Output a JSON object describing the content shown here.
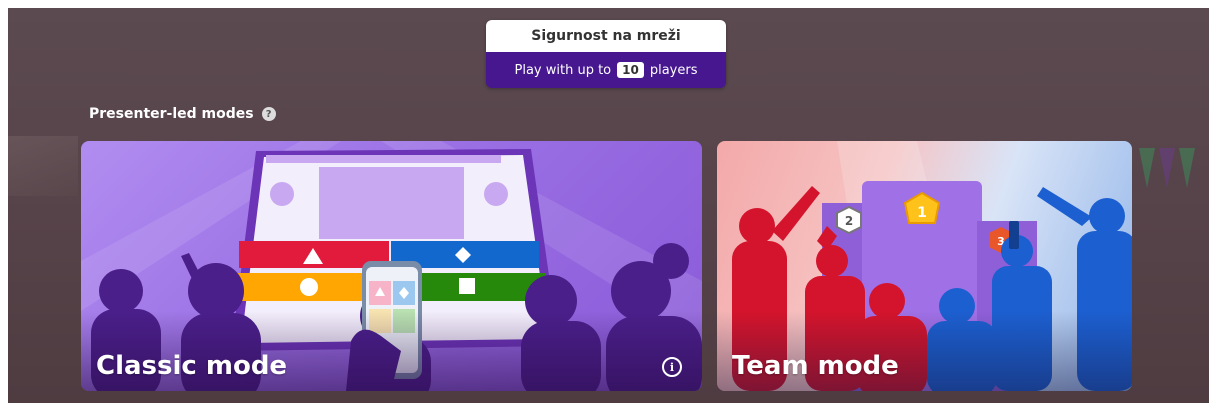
{
  "header": {
    "title": "Sigurnost na mreži",
    "players_prefix": "Play with up to",
    "player_count": "10",
    "players_suffix": "players"
  },
  "section": {
    "label": "Presenter-led modes",
    "help_icon": "?"
  },
  "modes": [
    {
      "title": "Classic mode",
      "info_icon": "i"
    },
    {
      "title": "Team mode"
    }
  ],
  "podium": {
    "first": "1",
    "second": "2",
    "third": "3"
  },
  "colors": {
    "brand_purple": "#46178f",
    "answer_red": "#e21b3c",
    "answer_blue": "#1368ce",
    "answer_yellow": "#ffa602",
    "answer_green": "#26890c"
  }
}
